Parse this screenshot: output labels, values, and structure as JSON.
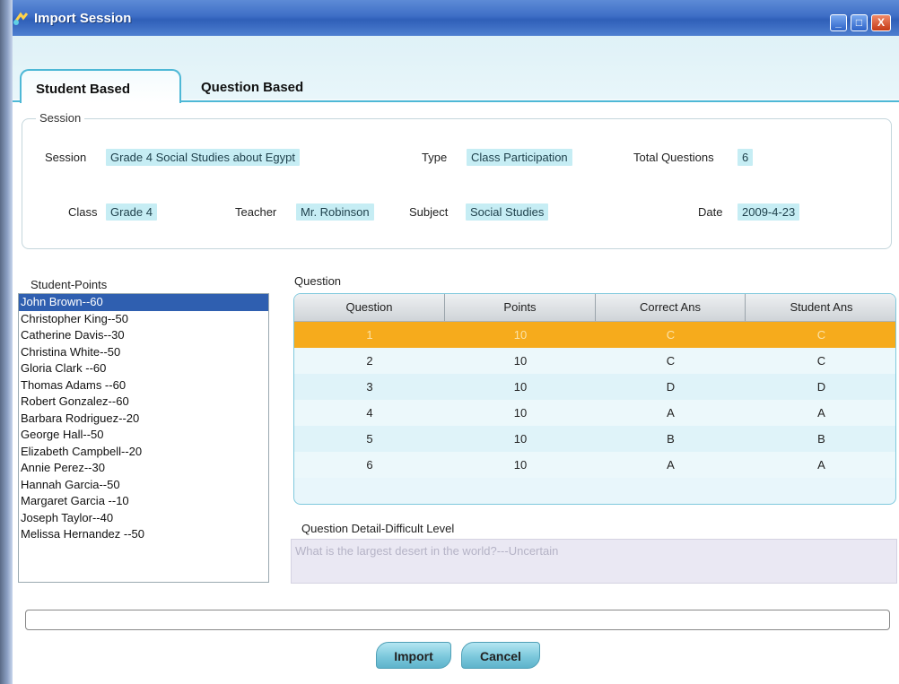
{
  "window": {
    "title": "Import Session",
    "minimize": "_",
    "maximize": "□",
    "close": "X"
  },
  "tabs": [
    {
      "label": "Student Based",
      "active": true
    },
    {
      "label": "Question Based",
      "active": false
    }
  ],
  "session": {
    "legend": "Session",
    "session_label": "Session",
    "session_value": "Grade 4 Social Studies about Egypt",
    "type_label": "Type",
    "type_value": "Class Participation",
    "total_label": "Total Questions",
    "total_value": "6",
    "class_label": "Class",
    "class_value": "Grade 4",
    "teacher_label": "Teacher",
    "teacher_value": "Mr. Robinson",
    "subject_label": "Subject",
    "subject_value": "Social Studies",
    "date_label": "Date",
    "date_value": "2009-4-23"
  },
  "students": {
    "label": "Student-Points",
    "items": [
      "John Brown--60",
      "Christopher  King--50",
      "Catherine Davis--30",
      "Christina White--50",
      "Gloria Clark --60",
      "Thomas Adams --60",
      "Robert Gonzalez--60",
      "Barbara Rodriguez--20",
      "George Hall--50",
      "Elizabeth Campbell--20",
      "Annie Perez--30",
      "Hannah Garcia--50",
      "Margaret Garcia  --10",
      "Joseph Taylor--40",
      "Melissa Hernandez  --50"
    ],
    "selected_index": 0
  },
  "questions": {
    "label": "Question",
    "columns": [
      "Question",
      "Points",
      "Correct Ans",
      "Student Ans"
    ],
    "rows": [
      [
        "1",
        "10",
        "C",
        "C"
      ],
      [
        "2",
        "10",
        "C",
        "C"
      ],
      [
        "3",
        "10",
        "D",
        "D"
      ],
      [
        "4",
        "10",
        "A",
        "A"
      ],
      [
        "5",
        "10",
        "B",
        "B"
      ],
      [
        "6",
        "10",
        "A",
        "A"
      ]
    ],
    "selected_index": 0
  },
  "detail": {
    "label": "Question Detail-Difficult Level",
    "text": "What is the largest desert in the world?---Uncertain"
  },
  "buttons": {
    "import": "Import",
    "cancel": "Cancel"
  },
  "colors": {
    "selection_row": "#f6ab1c",
    "selection_list": "#2f5fb0",
    "accent": "#4eb8d6"
  }
}
